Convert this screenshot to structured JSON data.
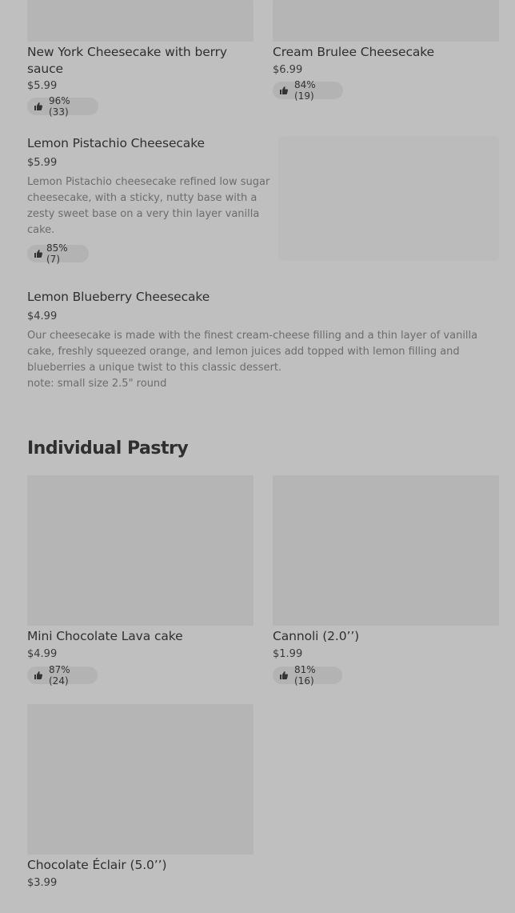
{
  "cheesecakes": {
    "ny": {
      "title": "New York Cheesecake with berry sauce",
      "price": "$5.99",
      "rating": "96% (33)"
    },
    "brulee": {
      "title": "Cream Brulee Cheesecake",
      "price": "$6.99",
      "rating": "84% (19)"
    },
    "pistachio": {
      "title": "Lemon Pistachio Cheesecake",
      "price": "$5.99",
      "description": "Lemon Pistachio cheesecake refined low sugar cheesecake, with a sticky, nutty base with a zesty sweet base on a very thin layer vanilla cake.",
      "rating": "85% (7)"
    },
    "blueberry": {
      "title": "Lemon Blueberry Cheesecake",
      "price": "$4.99",
      "description": "Our cheesecake is made with the finest cream-cheese filling and a thin layer of vanilla cake, freshly squeezed orange, and lemon juices add topped with lemon filling and blueberries a unique twist to this classic dessert.",
      "note": "note: small size 2.5\" round"
    }
  },
  "pastry": {
    "section_title": "Individual Pastry",
    "lava": {
      "title": "Mini Chocolate Lava cake",
      "price": "$4.99",
      "rating": "87% (24)"
    },
    "cannoli": {
      "title": "Cannoli (2.0’’)",
      "price": "$1.99",
      "rating": "81% (16)"
    },
    "eclair": {
      "title": "Chocolate Éclair (5.0’’)",
      "price": "$3.99"
    }
  },
  "icons": {
    "rating": "thumbs-up-icon"
  },
  "colors": {
    "overlay_background": "#bfbfbf",
    "image_placeholder": "#b5b5b5",
    "badge_background": "#b3b3b3"
  }
}
